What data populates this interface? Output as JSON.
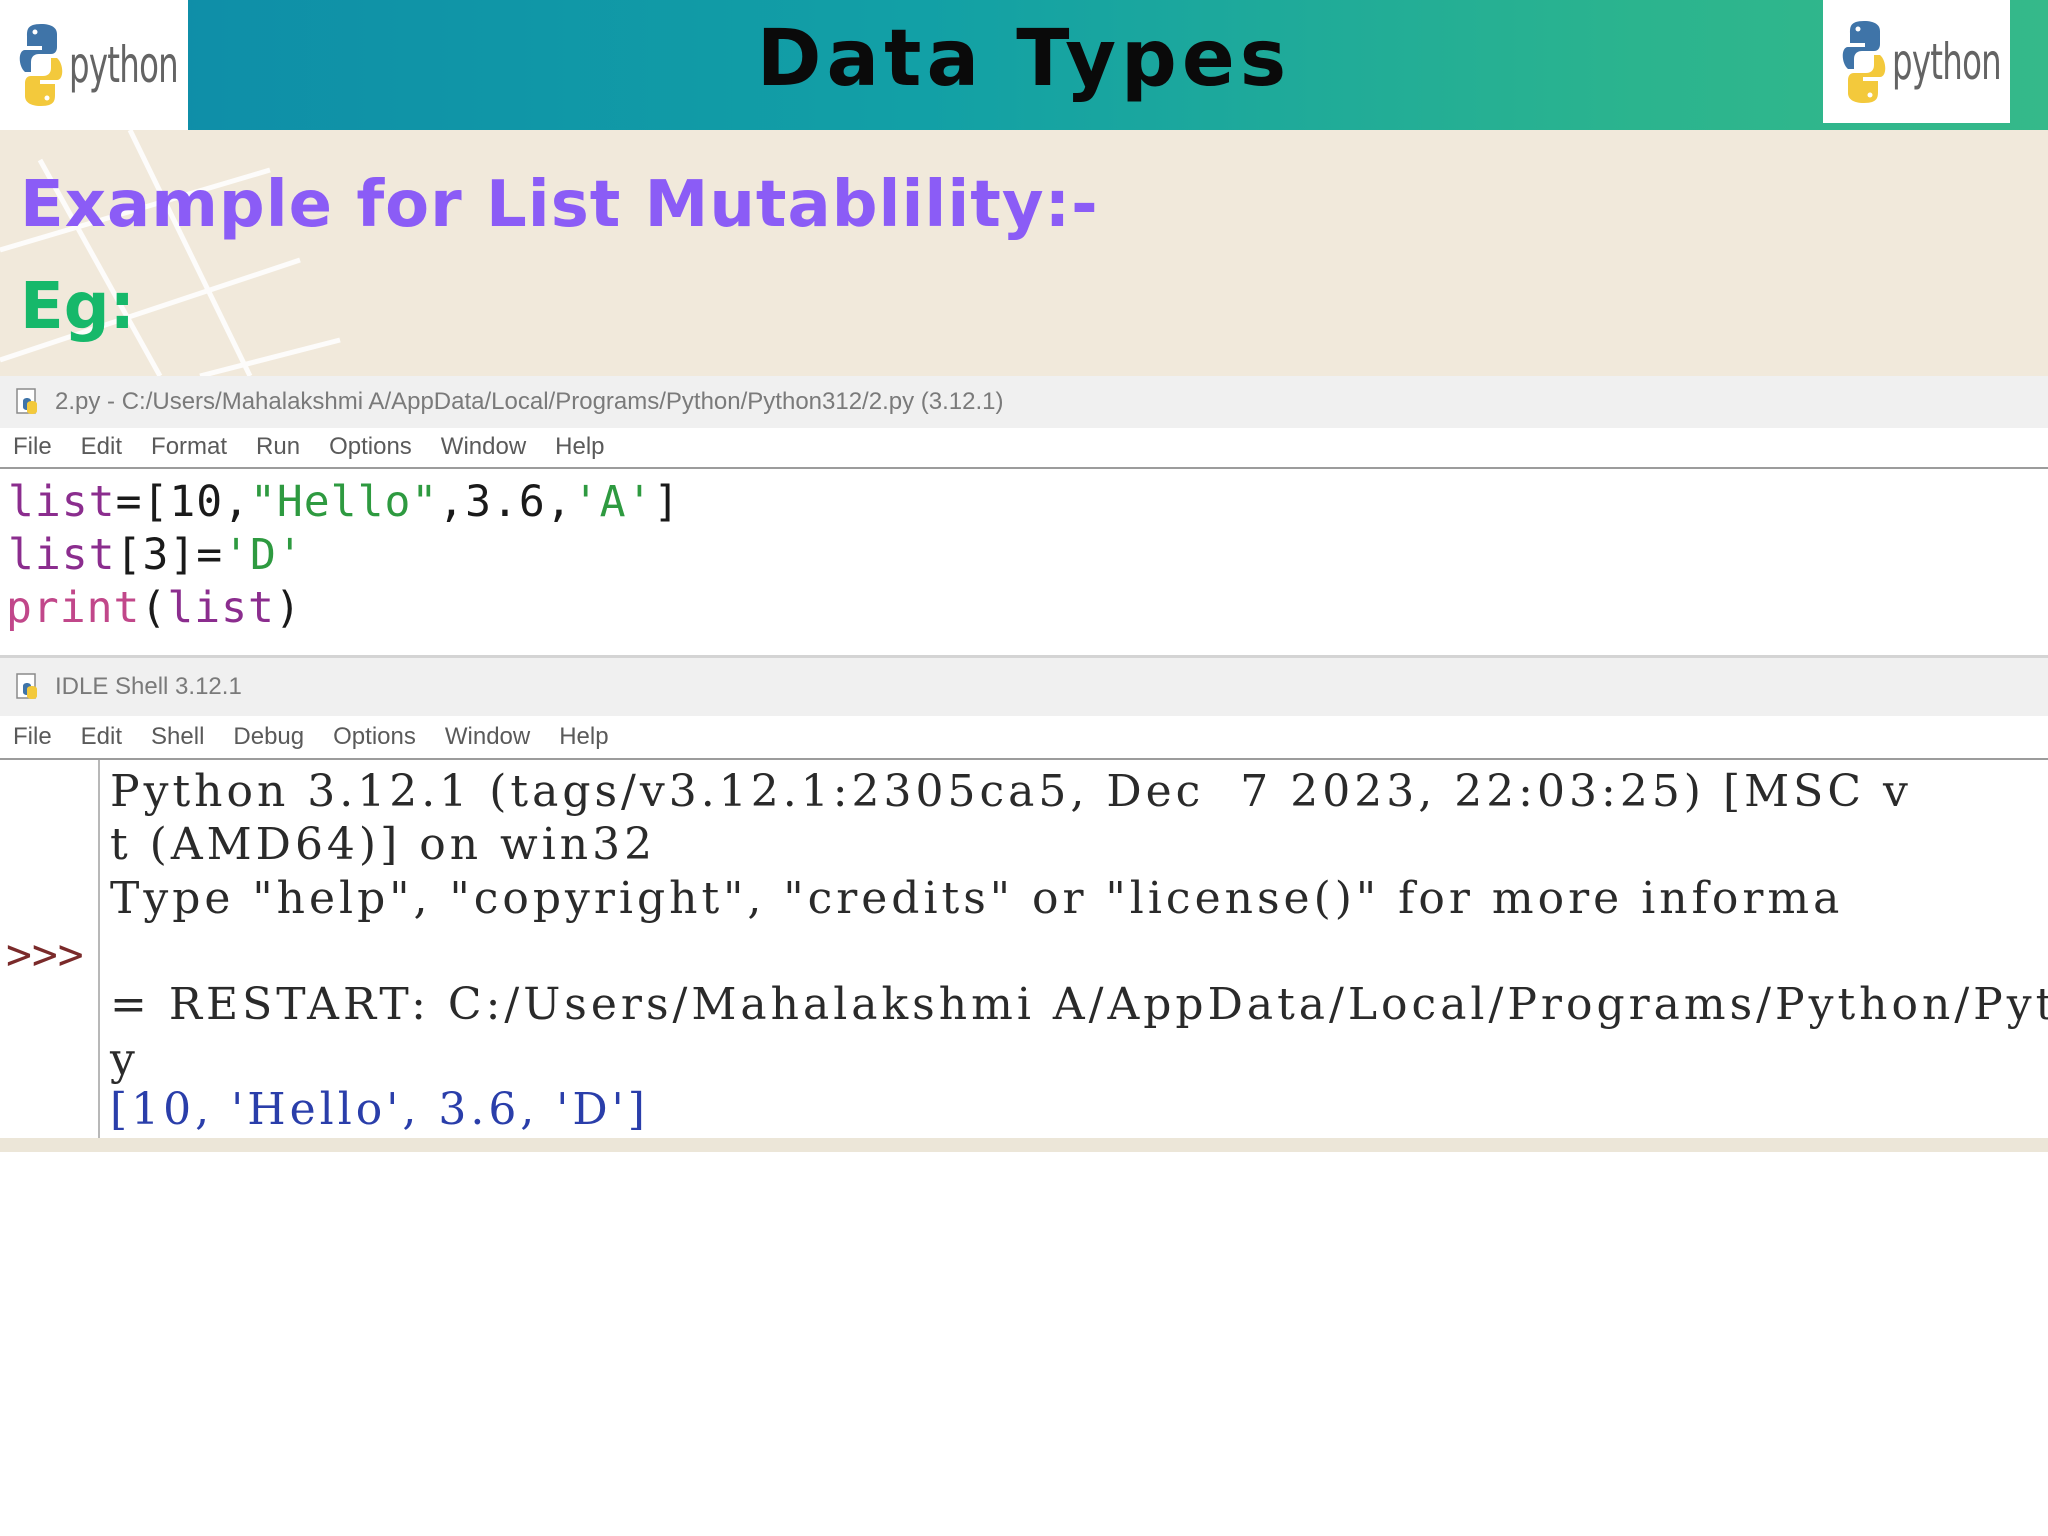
{
  "slide": {
    "title": "Data Types",
    "logo_text": "python",
    "subtitle": "Example for List Mutablility:-",
    "eg_label": "Eg:"
  },
  "editor_window": {
    "title": "2.py - C:/Users/Mahalakshmi A/AppData/Local/Programs/Python/Python312/2.py (3.12.1)",
    "menu": [
      "File",
      "Edit",
      "Format",
      "Run",
      "Options",
      "Window",
      "Help"
    ],
    "code": {
      "line1": {
        "name": "list",
        "op": "=[10,",
        "str1": "\"Hello\"",
        "mid": ",3.6,",
        "str2": "'A'",
        "end": "]"
      },
      "line2": {
        "name": "list",
        "op": "[3]=",
        "str1": "'D'"
      },
      "line3": {
        "fn": "print",
        "open": "(",
        "arg": "list",
        "close": ")"
      }
    }
  },
  "shell_window": {
    "title": "IDLE Shell 3.12.1",
    "menu": [
      "File",
      "Edit",
      "Shell",
      "Debug",
      "Options",
      "Window",
      "Help"
    ],
    "prompt": ">>>",
    "lines": [
      "Python 3.12.1 (tags/v3.12.1:2305ca5, Dec  7 2023, 22:03:25) [MSC v",
      "t (AMD64)] on win32",
      "Type \"help\", \"copyright\", \"credits\" or \"license()\" for more informa",
      "= RESTART: C:/Users/Mahalakshmi A/AppData/Local/Programs/Python/Pyt",
      "y"
    ],
    "output": "[10, 'Hello', 3.6, 'D']"
  },
  "colors": {
    "header_start": "#0e8aa8",
    "header_end": "#35b98a",
    "subtitle": "#8b5cf6",
    "eg": "#16b86a",
    "band_bg": "#f1e9db"
  }
}
